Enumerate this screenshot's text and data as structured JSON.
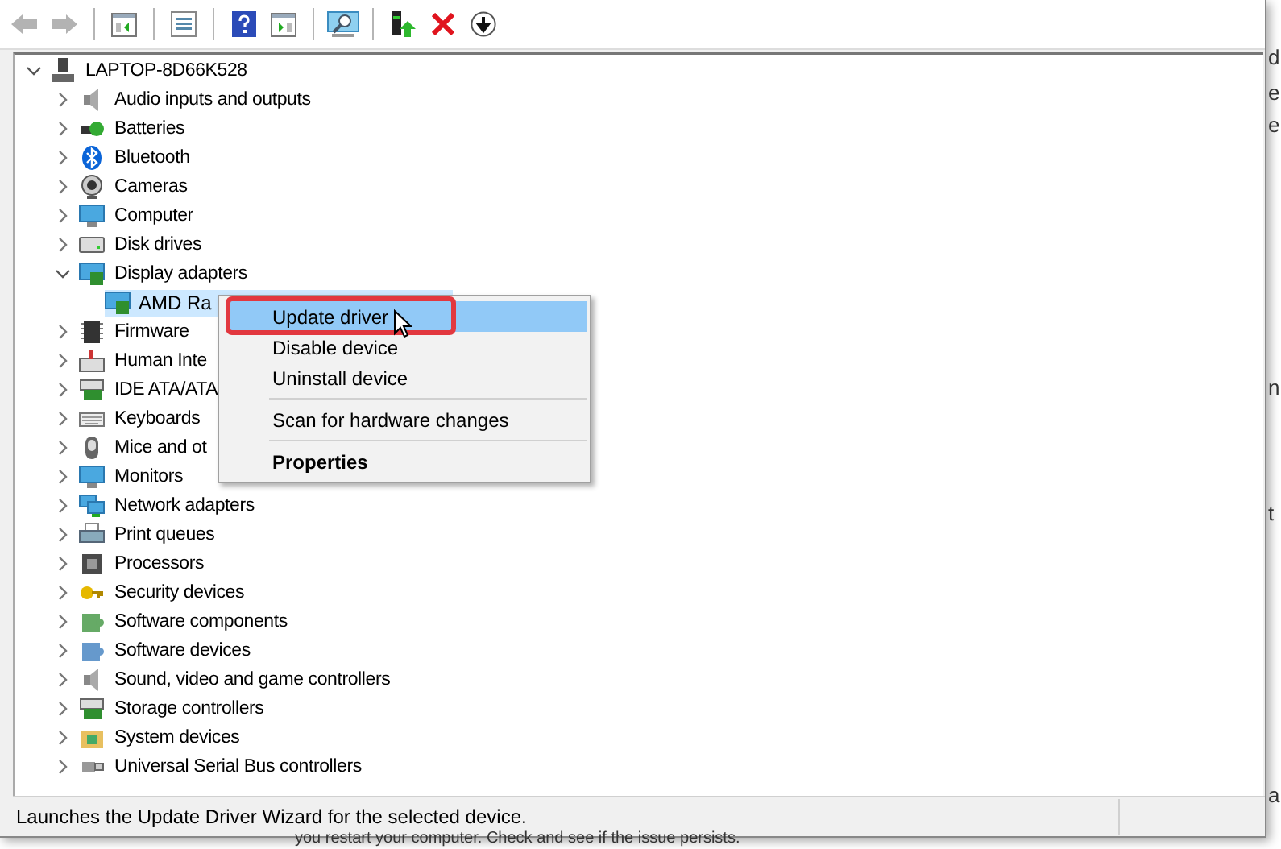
{
  "toolbar": {
    "buttons": [
      {
        "kind": "back",
        "disabled": true
      },
      {
        "kind": "forward",
        "disabled": true
      },
      {
        "kind": "separator"
      },
      {
        "kind": "console-tree"
      },
      {
        "kind": "separator"
      },
      {
        "kind": "properties"
      },
      {
        "kind": "separator"
      },
      {
        "kind": "help"
      },
      {
        "kind": "action-pane"
      },
      {
        "kind": "separator"
      },
      {
        "kind": "scan"
      },
      {
        "kind": "separator"
      },
      {
        "kind": "update"
      },
      {
        "kind": "uninstall"
      },
      {
        "kind": "disable"
      }
    ]
  },
  "tree": {
    "label": "LAPTOP-8D66K528",
    "expanded": true,
    "children": [
      {
        "label": "Audio inputs and outputs",
        "expanded": false,
        "selected": false
      },
      {
        "label": "Batteries",
        "expanded": false,
        "selected": false
      },
      {
        "label": "Bluetooth",
        "expanded": false,
        "selected": false
      },
      {
        "label": "Cameras",
        "expanded": false,
        "selected": false
      },
      {
        "label": "Computer",
        "expanded": false,
        "selected": false
      },
      {
        "label": "Disk drives",
        "expanded": false,
        "selected": false
      },
      {
        "label": "Display adapters",
        "expanded": true,
        "selected": false,
        "children": [
          {
            "label": "AMD Ra",
            "selected": true
          }
        ]
      },
      {
        "label": "Firmware",
        "expanded": false,
        "selected": false
      },
      {
        "label": "Human Inte",
        "expanded": false,
        "selected": false
      },
      {
        "label": "IDE ATA/ATA",
        "expanded": false,
        "selected": false
      },
      {
        "label": "Keyboards",
        "expanded": false,
        "selected": false
      },
      {
        "label": "Mice and ot",
        "expanded": false,
        "selected": false
      },
      {
        "label": "Monitors",
        "expanded": false,
        "selected": false
      },
      {
        "label": "Network adapters",
        "expanded": false,
        "selected": false
      },
      {
        "label": "Print queues",
        "expanded": false,
        "selected": false
      },
      {
        "label": "Processors",
        "expanded": false,
        "selected": false
      },
      {
        "label": "Security devices",
        "expanded": false,
        "selected": false
      },
      {
        "label": "Software components",
        "expanded": false,
        "selected": false
      },
      {
        "label": "Software devices",
        "expanded": false,
        "selected": false
      },
      {
        "label": "Sound, video and game controllers",
        "expanded": false,
        "selected": false
      },
      {
        "label": "Storage controllers",
        "expanded": false,
        "selected": false
      },
      {
        "label": "System devices",
        "expanded": false,
        "selected": false
      },
      {
        "label": "Universal Serial Bus controllers",
        "expanded": false,
        "selected": false
      }
    ]
  },
  "context_menu": {
    "items": [
      {
        "kind": "item",
        "label": "Update driver",
        "selected": true,
        "default": false
      },
      {
        "kind": "item",
        "label": "Disable device",
        "selected": false,
        "default": false
      },
      {
        "kind": "item",
        "label": "Uninstall device",
        "selected": false,
        "default": false
      },
      {
        "kind": "separator"
      },
      {
        "kind": "item",
        "label": "Scan for hardware changes",
        "selected": false,
        "default": false
      },
      {
        "kind": "separator"
      },
      {
        "kind": "item",
        "label": "Properties",
        "selected": false,
        "default": true
      }
    ]
  },
  "status_bar": {
    "text": "Launches the Update Driver Wizard for the selected device."
  },
  "background": {
    "fragments": [
      "d",
      "e",
      "e",
      "n",
      "t",
      "a"
    ],
    "bottom_text": "you restart your computer. Check and see if the issue persists."
  }
}
